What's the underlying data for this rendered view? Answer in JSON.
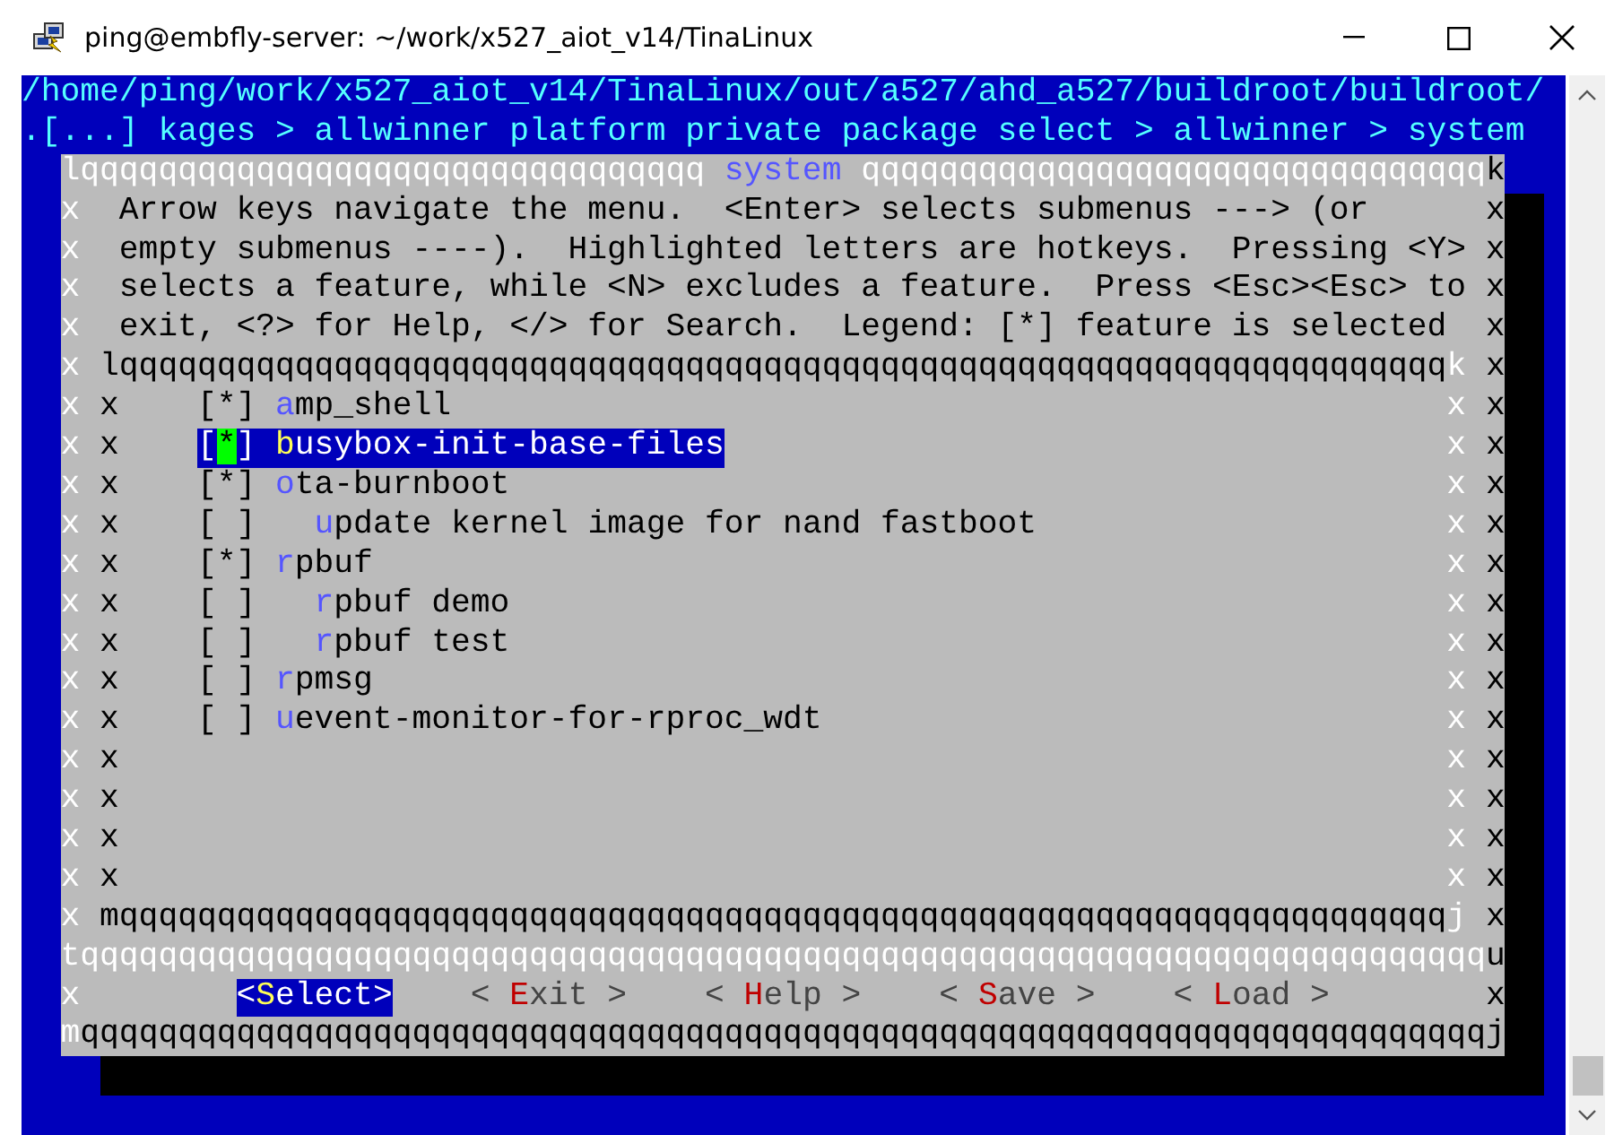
{
  "window": {
    "title": "ping@embfly-server: ~/work/x527_aiot_v14/TinaLinux"
  },
  "terminal": {
    "path": "/home/ping/work/x527_aiot_v14/TinaLinux/out/a527/ahd_a527/buildroot/buildroot/",
    "breadcrumb": ".[...] kages > allwinner platform private package select > allwinner > system",
    "dialog": {
      "title": "system",
      "top": {
        "left": "lqqqqqqqqqqqqqqqqqqqqqqqqqqqqqqqq",
        "right": "qqqqqqqqqqqqqqqqqqqqqqqqqqqqqqqq",
        "corner": "k"
      },
      "help_lines": [
        {
          "border": [
            "x",
            "x"
          ],
          "text": " Arrow keys navigate the menu.  <Enter> selects submenus ---> (or"
        },
        {
          "border": [
            "x",
            "x"
          ],
          "text": " empty submenus ----).  Highlighted letters are hotkeys.  Pressing <Y>"
        },
        {
          "border": [
            "x",
            "x"
          ],
          "text": " selects a feature, while <N> excludes a feature.  Press <Esc><Esc> to"
        },
        {
          "border": [
            "x",
            "x"
          ],
          "text": " exit, <?> for Help, </> for Search.  Legend: [*] feature is selected"
        }
      ],
      "inner_top": {
        "border": [
          "x",
          "x"
        ],
        "line": "lqqqqqqqqqqqqqqqqqqqqqqqqqqqqqqqqqqqqqqqqqqqqqqqqqqqqqqqqqqqqqqqqqqqq",
        "corner": "k"
      },
      "items": [
        {
          "border": [
            "x",
            "x",
            "x",
            "x"
          ],
          "box": "[*]",
          "label": "amp_shell",
          "selected": false
        },
        {
          "border": [
            "x",
            "x",
            "x",
            "x"
          ],
          "box": "[*]",
          "label": "busybox-init-base-files",
          "selected": true
        },
        {
          "border": [
            "x",
            "x",
            "x",
            "x"
          ],
          "box": "[*]",
          "label": "ota-burnboot",
          "selected": false,
          "children": [
            {
              "border": [
                "x",
                "x",
                "x",
                "x"
              ],
              "box": "[ ]",
              "label": "update kernel image for nand fastboot",
              "selected": false
            }
          ]
        },
        {
          "border": [
            "x",
            "x",
            "x",
            "x"
          ],
          "box": "[*]",
          "label": "rpbuf",
          "selected": false,
          "children": [
            {
              "border": [
                "x",
                "x",
                "x",
                "x"
              ],
              "box": "[ ]",
              "label": "rpbuf demo",
              "selected": false
            },
            {
              "border": [
                "x",
                "x",
                "x",
                "x"
              ],
              "box": "[ ]",
              "label": "rpbuf test",
              "selected": false
            }
          ]
        },
        {
          "border": [
            "x",
            "x",
            "x",
            "x"
          ],
          "box": "[ ]",
          "label": "rpmsg",
          "selected": false
        },
        {
          "border": [
            "x",
            "x",
            "x",
            "x"
          ],
          "box": "[ ]",
          "label": "uevent-monitor-for-rproc_wdt",
          "selected": false
        }
      ],
      "blank_rows": [
        {
          "border": [
            "x",
            "x",
            "x",
            "x"
          ]
        },
        {
          "border": [
            "x",
            "x",
            "x",
            "x"
          ]
        },
        {
          "border": [
            "x",
            "x",
            "x",
            "x"
          ]
        },
        {
          "border": [
            "x",
            "x",
            "x",
            "x"
          ]
        }
      ],
      "inner_bottom": {
        "border": [
          "x",
          "x"
        ],
        "line": "mqqqqqqqqqqqqqqqqqqqqqqqqqqqqqqqqqqqqqqqqqqqqqqqqqqqqqqqqqqqqqqqqqqqq",
        "corner": "j"
      },
      "separator": {
        "line": "tqqqqqqqqqqqqqqqqqqqqqqqqqqqqqqqqqqqqqqqqqqqqqqqqqqqqqqqqqqqqqqqqqqqqqqqq",
        "corner": "u"
      },
      "button_row_border": [
        "x",
        "x"
      ],
      "buttons": [
        {
          "label": "<Select>",
          "selected": true
        },
        {
          "label": "< Exit >",
          "selected": false
        },
        {
          "label": "< Help >",
          "selected": false
        },
        {
          "label": "< Save >",
          "selected": false
        },
        {
          "label": "< Load >",
          "selected": false
        }
      ],
      "bottom": {
        "corner": "m",
        "line": "qqqqqqqqqqqqqqqqqqqqqqqqqqqqqqqqqqqqqqqqqqqqqqqqqqqqqqqqqqqqqqqqqqqqqqqqj"
      }
    }
  }
}
